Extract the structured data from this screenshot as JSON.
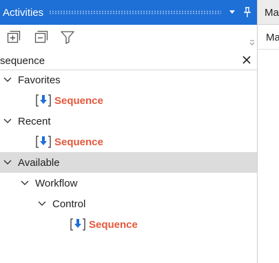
{
  "panel": {
    "title": "Activities",
    "title_buttons": [
      "chevron-down-icon",
      "pin-icon"
    ],
    "toolbar": [
      "expand-all-icon",
      "collapse-all-icon",
      "filter-icon"
    ]
  },
  "search": {
    "value": "sequence",
    "clear_icon": "close-icon"
  },
  "tree": {
    "favorites": {
      "label": "Favorites",
      "items": [
        {
          "label": "Sequence",
          "icon": "sequence-activity-icon"
        }
      ]
    },
    "recent": {
      "label": "Recent",
      "items": [
        {
          "label": "Sequence",
          "icon": "sequence-activity-icon"
        }
      ]
    },
    "available": {
      "label": "Available",
      "workflow": {
        "label": "Workflow",
        "control": {
          "label": "Control",
          "items": [
            {
              "label": "Sequence",
              "icon": "sequence-activity-icon"
            }
          ]
        }
      }
    }
  },
  "right_panel": {
    "tab_label": "Ma",
    "sub_label": "Ma"
  },
  "colors": {
    "titlebar": "#1e6fd6",
    "accent_text": "#e4583b",
    "selected_row": "#dcdcdc"
  }
}
